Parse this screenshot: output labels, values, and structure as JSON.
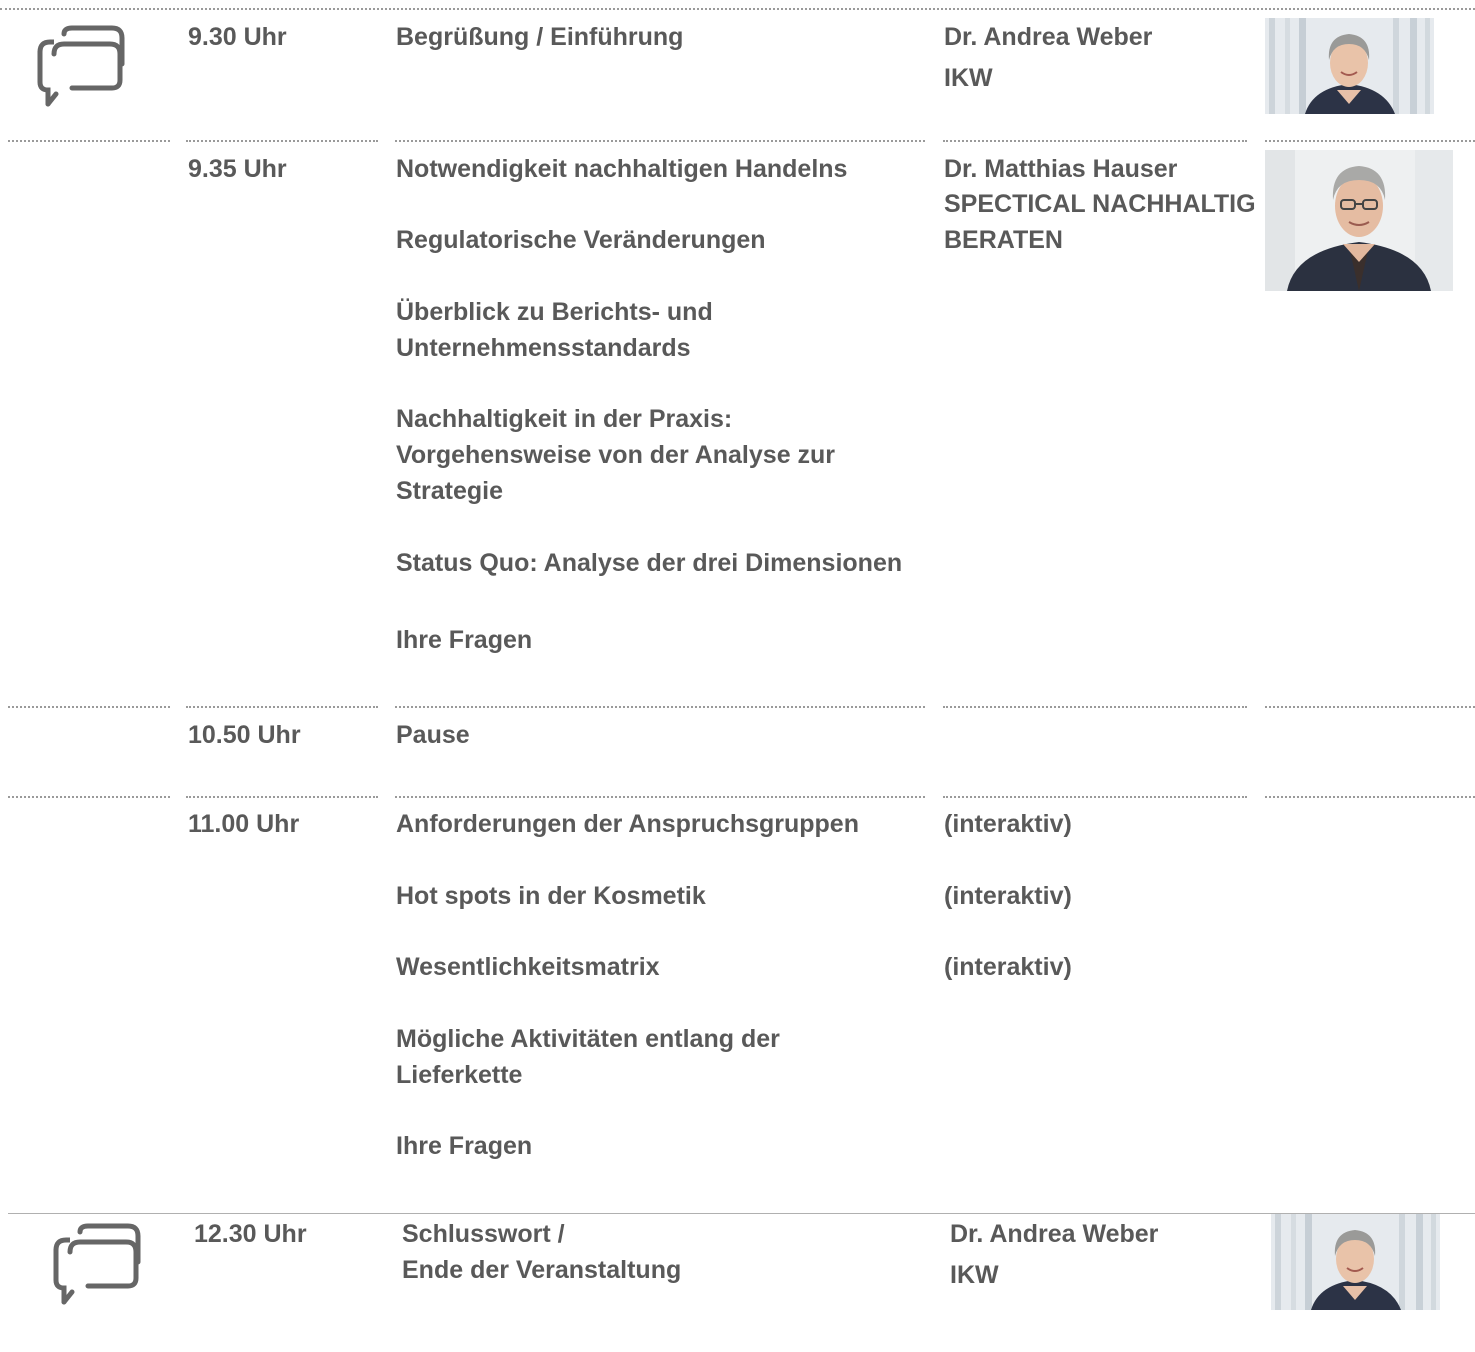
{
  "sessions": [
    {
      "time": "9.30 Uhr",
      "topics": [
        "Begrüßung / Einführung"
      ],
      "speaker": "Dr. Andrea Weber",
      "org": "IKW"
    },
    {
      "time": "9.35 Uhr",
      "topics": [
        "Notwendigkeit nachhaltigen Handelns",
        "Regulatorische Veränderungen",
        "Überblick zu Berichts- und",
        "Unternehmensstandards",
        "Nachhaltigkeit in der Praxis:",
        "Vorgehensweise von der Analyse zur",
        "Strategie",
        "Status Quo: Analyse der drei Dimensionen",
        "Ihre Fragen"
      ],
      "speaker": "Dr. Matthias Hauser",
      "org_lines": [
        "SPECTICAL NACHHALTIG",
        "BERATEN"
      ]
    },
    {
      "time": "10.50 Uhr",
      "topics": [
        "Pause"
      ]
    },
    {
      "time": "11.00 Uhr",
      "topics": [
        "Anforderungen der Anspruchsgruppen",
        "Hot spots in der Kosmetik",
        "Wesentlichkeitsmatrix",
        "Mögliche Aktivitäten entlang der",
        "Lieferkette",
        "Ihre Fragen"
      ],
      "notes": [
        "(interaktiv)",
        "(interaktiv)",
        "(interaktiv)"
      ]
    },
    {
      "time": "12.30 Uhr",
      "topics": [
        "Schlusswort /",
        "Ende der Veranstaltung"
      ],
      "speaker": "Dr. Andrea Weber",
      "org": "IKW"
    }
  ],
  "icons": {
    "chat": "chat-bubbles-icon"
  },
  "colors": {
    "text": "#595959",
    "divider": "#9a9a9a"
  }
}
